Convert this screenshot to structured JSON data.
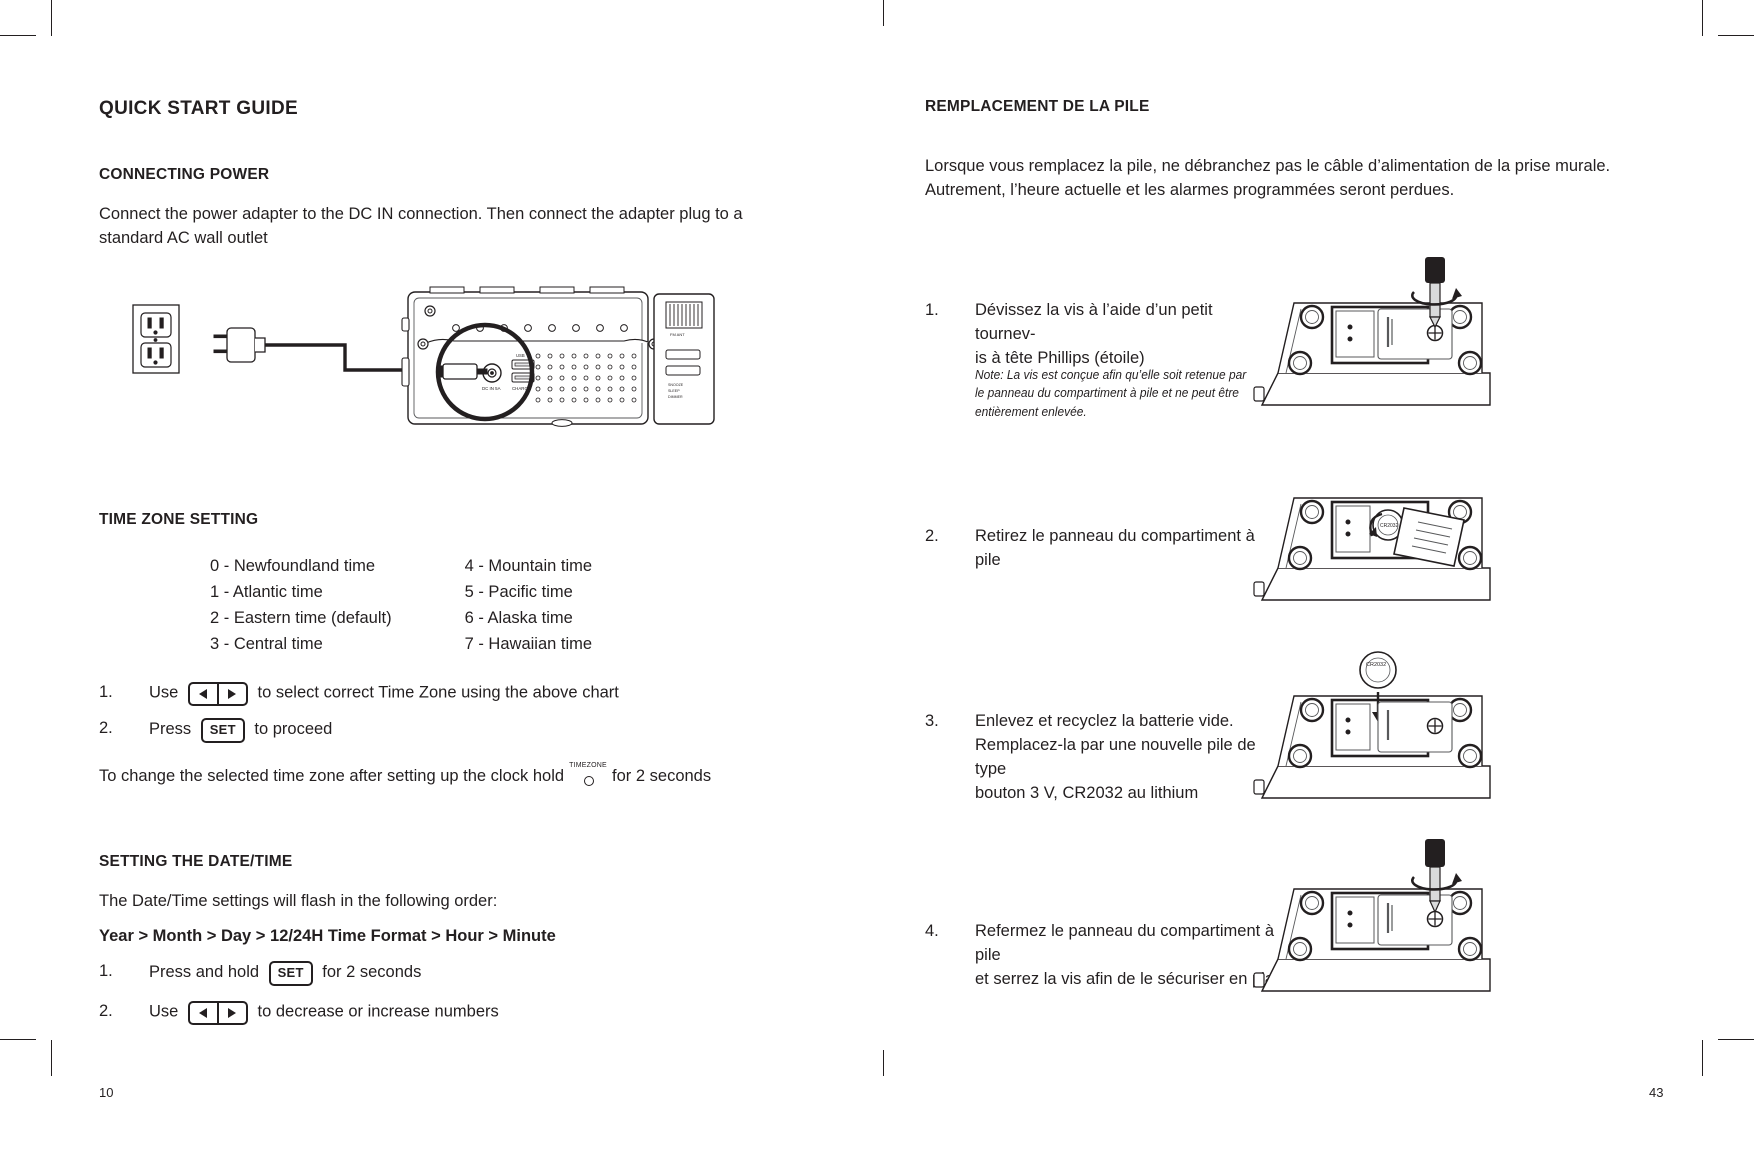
{
  "left_page": {
    "title": "QUICK START GUIDE",
    "page_number": "10",
    "sections": {
      "connecting_power": {
        "heading": "CONNECTING POWER",
        "body": "Connect the power adapter to the DC IN connection. Then connect the adapter plug to a standard AC wall outlet"
      },
      "time_zone": {
        "heading": "TIME ZONE SETTING",
        "zones_col1": [
          "0 - Newfoundland time",
          "1 - Atlantic time",
          "2 - Eastern time (default)",
          "3 - Central time"
        ],
        "zones_col2": [
          "4 - Mountain time",
          "5 - Pacific time",
          "6 - Alaska time",
          "7 - Hawaiian time"
        ],
        "step1_num": "1.",
        "step1_pre": "Use",
        "step1_post": "to select correct Time Zone using the above chart",
        "step2_num": "2.",
        "step2_pre": "Press",
        "step2_post": "to proceed",
        "set_label": "SET",
        "timezone_label": "TIMEZONE",
        "change_pre": "To change the selected time zone after setting up the clock hold",
        "change_post": "for 2 seconds"
      },
      "date_time": {
        "heading": "SETTING THE DATE/TIME",
        "intro": "The Date/Time settings will flash in the following order:",
        "order": "Year > Month > Day > 12/24H Time Format > Hour > Minute",
        "step1_num": "1.",
        "step1_pre": "Press and hold",
        "step1_post": "for 2 seconds",
        "set_label": "SET",
        "step2_num": "2.",
        "step2_pre": "Use",
        "step2_post": "to decrease or increase numbers"
      }
    },
    "illustration_labels": {
      "dc_in": "DC IN 5A",
      "charge": "CHARGE",
      "usb": "USB",
      "fm": "FM ANT",
      "side_text": "SNOOZE / SLEEP / DIMMER"
    }
  },
  "right_page": {
    "title": "REMPLACEMENT DE LA PILE",
    "page_number": "43",
    "intro": "Lorsque vous remplacez la pile, ne débranchez pas le câble d’alimentation de la prise murale. Autrement, l’heure actuelle et les alarmes programmées seront perdues.",
    "steps": [
      {
        "num": "1.",
        "text": "Dévissez la vis à l’aide d’un petit tournev-is à tête Phillips (étoile)",
        "line1": "Dévissez la vis à l’aide d’un petit tournev-",
        "line2": "is à tête Phillips (étoile)",
        "note_line1": "Note: La vis est conçue afin qu’elle soit retenue par",
        "note_line2": "le panneau du compartiment à pile et ne peut être",
        "note_line3": "entièrement enlevée."
      },
      {
        "num": "2.",
        "line1": "Retirez le panneau du compartiment à pile"
      },
      {
        "num": "3.",
        "line1": "Enlevez et recyclez la batterie vide.",
        "line2": "Remplacez-la par une nouvelle pile de type",
        "line3": "bouton 3 V, CR2032 au lithium"
      },
      {
        "num": "4.",
        "line1": "Refermez le panneau du compartiment à pile",
        "line2": "et serrez la vis afin de le sécuriser en place"
      }
    ],
    "illustration_labels": {
      "battery_type": "CR2032"
    }
  },
  "colors": {
    "ink": "#231f20",
    "line": "#58595b",
    "fill_light": "#e6e7e8"
  }
}
